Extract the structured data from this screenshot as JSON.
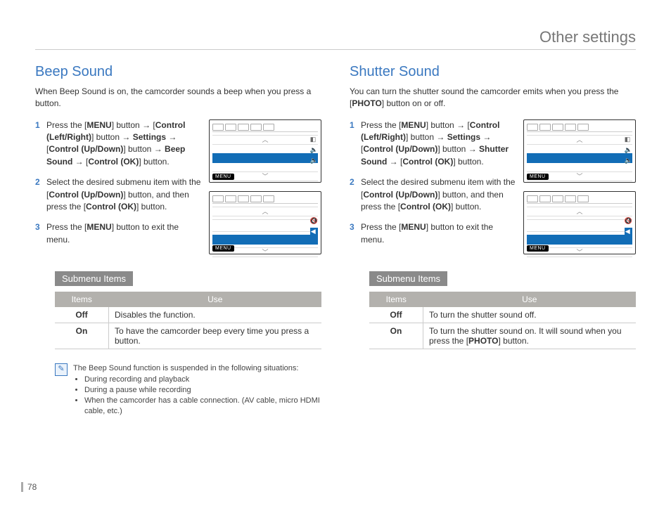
{
  "pageTitle": "Other settings",
  "pageNumber": "78",
  "left": {
    "title": "Beep Sound",
    "intro": "When Beep Sound is on, the camcorder sounds a beep when you press a button.",
    "step1": {
      "n": "1",
      "a": "Press the [",
      "menu": "MENU",
      "b": "] button ",
      "arr": "→",
      "c": " [",
      "ctrlLR": "Control (Left/Right)",
      "d": "] button ",
      "arr2": "→",
      "e": " ",
      "settings": "Settings",
      "f": " ",
      "arr3": "→",
      "g": " [",
      "ctrlUD": "Control (Up/Down)",
      "h": "] button ",
      "arr4": "→",
      "i": " ",
      "beep": "Beep Sound",
      "j": " ",
      "arr5": "→",
      "k": " [",
      "ctrlOK": "Control (OK)",
      "l": "] button."
    },
    "step2": {
      "n": "2",
      "text1": "Select the desired submenu item with the [",
      "b1": "Control (Up/Down)",
      "text2": "] button, and then press the [",
      "b2": "Control (OK)",
      "text3": "] button."
    },
    "step3": {
      "n": "3",
      "text1": "Press the [",
      "b1": "MENU",
      "text2": "] button to exit the menu."
    },
    "submenuLabel": "Submenu Items",
    "th1": "Items",
    "th2": "Use",
    "row1": {
      "item": "Off",
      "use": "Disables the function."
    },
    "row2": {
      "item": "On",
      "use": "To have the camcorder beep every time you press a button."
    },
    "note": {
      "lead": "The Beep Sound function is suspended in the following situations:",
      "l1": "During recording and playback",
      "l2": "During a pause while recording",
      "l3": "When the camcorder has a cable connection. (AV cable, micro HDMI cable, etc.)"
    },
    "figLabel": "MENU"
  },
  "right": {
    "title": "Shutter Sound",
    "intro1": "You can turn the shutter sound the camcorder emits when you press the [",
    "introB": "PHOTO",
    "intro2": "] button on or off.",
    "step1": {
      "n": "1",
      "a": "Press the [",
      "menu": "MENU",
      "b": "] button ",
      "arr": "→",
      "c": " [",
      "ctrlLR": "Control (Left/Right)",
      "d": "] button ",
      "arr2": "→",
      "e": " ",
      "settings": "Settings",
      "f": " ",
      "arr3": "→",
      "g": " [",
      "ctrlUD": "Control (Up/Down)",
      "h": "] button ",
      "arr4": "→",
      "i": " ",
      "shutter": "Shutter Sound",
      "j": " ",
      "arr5": "→",
      "k": " [",
      "ctrlOK": "Control (OK)",
      "l": "] button."
    },
    "step2": {
      "n": "2",
      "text1": "Select the desired submenu item with the [",
      "b1": "Control (Up/Down)",
      "text2": "] button, and then press the [",
      "b2": "Control (OK)",
      "text3": "] button."
    },
    "step3": {
      "n": "3",
      "text1": "Press the [",
      "b1": "MENU",
      "text2": "] button to exit the menu."
    },
    "submenuLabel": "Submenu Items",
    "th1": "Items",
    "th2": "Use",
    "row1": {
      "item": "Off",
      "use": "To turn the shutter sound off."
    },
    "row2": {
      "item": "On",
      "use1": "To turn the shutter sound on. It will sound when you press the [",
      "b": "PHOTO",
      "use2": "] button."
    },
    "figLabel": "MENU"
  }
}
